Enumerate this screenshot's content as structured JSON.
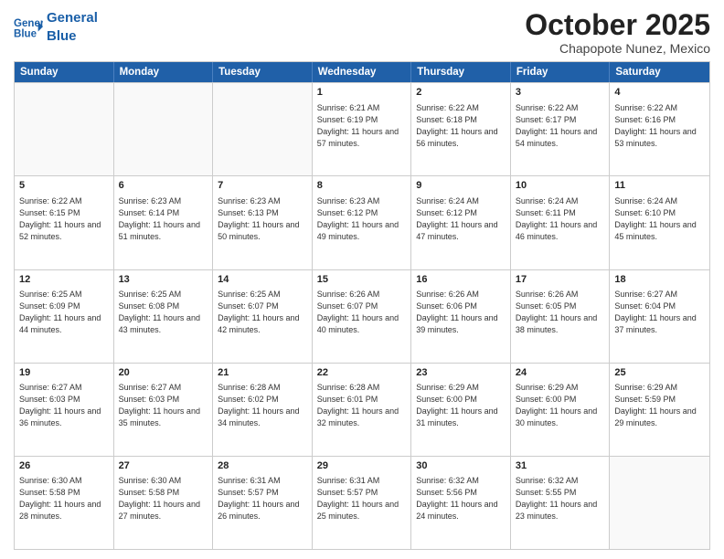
{
  "header": {
    "logo_line1": "General",
    "logo_line2": "Blue",
    "month": "October 2025",
    "location": "Chapopote Nunez, Mexico"
  },
  "days_of_week": [
    "Sunday",
    "Monday",
    "Tuesday",
    "Wednesday",
    "Thursday",
    "Friday",
    "Saturday"
  ],
  "weeks": [
    [
      {
        "day": "",
        "info": ""
      },
      {
        "day": "",
        "info": ""
      },
      {
        "day": "",
        "info": ""
      },
      {
        "day": "1",
        "info": "Sunrise: 6:21 AM\nSunset: 6:19 PM\nDaylight: 11 hours and 57 minutes."
      },
      {
        "day": "2",
        "info": "Sunrise: 6:22 AM\nSunset: 6:18 PM\nDaylight: 11 hours and 56 minutes."
      },
      {
        "day": "3",
        "info": "Sunrise: 6:22 AM\nSunset: 6:17 PM\nDaylight: 11 hours and 54 minutes."
      },
      {
        "day": "4",
        "info": "Sunrise: 6:22 AM\nSunset: 6:16 PM\nDaylight: 11 hours and 53 minutes."
      }
    ],
    [
      {
        "day": "5",
        "info": "Sunrise: 6:22 AM\nSunset: 6:15 PM\nDaylight: 11 hours and 52 minutes."
      },
      {
        "day": "6",
        "info": "Sunrise: 6:23 AM\nSunset: 6:14 PM\nDaylight: 11 hours and 51 minutes."
      },
      {
        "day": "7",
        "info": "Sunrise: 6:23 AM\nSunset: 6:13 PM\nDaylight: 11 hours and 50 minutes."
      },
      {
        "day": "8",
        "info": "Sunrise: 6:23 AM\nSunset: 6:12 PM\nDaylight: 11 hours and 49 minutes."
      },
      {
        "day": "9",
        "info": "Sunrise: 6:24 AM\nSunset: 6:12 PM\nDaylight: 11 hours and 47 minutes."
      },
      {
        "day": "10",
        "info": "Sunrise: 6:24 AM\nSunset: 6:11 PM\nDaylight: 11 hours and 46 minutes."
      },
      {
        "day": "11",
        "info": "Sunrise: 6:24 AM\nSunset: 6:10 PM\nDaylight: 11 hours and 45 minutes."
      }
    ],
    [
      {
        "day": "12",
        "info": "Sunrise: 6:25 AM\nSunset: 6:09 PM\nDaylight: 11 hours and 44 minutes."
      },
      {
        "day": "13",
        "info": "Sunrise: 6:25 AM\nSunset: 6:08 PM\nDaylight: 11 hours and 43 minutes."
      },
      {
        "day": "14",
        "info": "Sunrise: 6:25 AM\nSunset: 6:07 PM\nDaylight: 11 hours and 42 minutes."
      },
      {
        "day": "15",
        "info": "Sunrise: 6:26 AM\nSunset: 6:07 PM\nDaylight: 11 hours and 40 minutes."
      },
      {
        "day": "16",
        "info": "Sunrise: 6:26 AM\nSunset: 6:06 PM\nDaylight: 11 hours and 39 minutes."
      },
      {
        "day": "17",
        "info": "Sunrise: 6:26 AM\nSunset: 6:05 PM\nDaylight: 11 hours and 38 minutes."
      },
      {
        "day": "18",
        "info": "Sunrise: 6:27 AM\nSunset: 6:04 PM\nDaylight: 11 hours and 37 minutes."
      }
    ],
    [
      {
        "day": "19",
        "info": "Sunrise: 6:27 AM\nSunset: 6:03 PM\nDaylight: 11 hours and 36 minutes."
      },
      {
        "day": "20",
        "info": "Sunrise: 6:27 AM\nSunset: 6:03 PM\nDaylight: 11 hours and 35 minutes."
      },
      {
        "day": "21",
        "info": "Sunrise: 6:28 AM\nSunset: 6:02 PM\nDaylight: 11 hours and 34 minutes."
      },
      {
        "day": "22",
        "info": "Sunrise: 6:28 AM\nSunset: 6:01 PM\nDaylight: 11 hours and 32 minutes."
      },
      {
        "day": "23",
        "info": "Sunrise: 6:29 AM\nSunset: 6:00 PM\nDaylight: 11 hours and 31 minutes."
      },
      {
        "day": "24",
        "info": "Sunrise: 6:29 AM\nSunset: 6:00 PM\nDaylight: 11 hours and 30 minutes."
      },
      {
        "day": "25",
        "info": "Sunrise: 6:29 AM\nSunset: 5:59 PM\nDaylight: 11 hours and 29 minutes."
      }
    ],
    [
      {
        "day": "26",
        "info": "Sunrise: 6:30 AM\nSunset: 5:58 PM\nDaylight: 11 hours and 28 minutes."
      },
      {
        "day": "27",
        "info": "Sunrise: 6:30 AM\nSunset: 5:58 PM\nDaylight: 11 hours and 27 minutes."
      },
      {
        "day": "28",
        "info": "Sunrise: 6:31 AM\nSunset: 5:57 PM\nDaylight: 11 hours and 26 minutes."
      },
      {
        "day": "29",
        "info": "Sunrise: 6:31 AM\nSunset: 5:57 PM\nDaylight: 11 hours and 25 minutes."
      },
      {
        "day": "30",
        "info": "Sunrise: 6:32 AM\nSunset: 5:56 PM\nDaylight: 11 hours and 24 minutes."
      },
      {
        "day": "31",
        "info": "Sunrise: 6:32 AM\nSunset: 5:55 PM\nDaylight: 11 hours and 23 minutes."
      },
      {
        "day": "",
        "info": ""
      }
    ]
  ]
}
